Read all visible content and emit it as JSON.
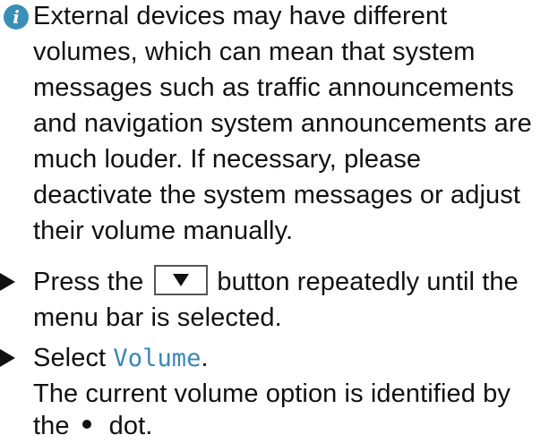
{
  "note": {
    "icon": "info-icon",
    "lines": [
      "External devices may have different",
      "volumes, which can mean that system",
      "messages such as traffic announcements",
      "and navigation system announcements are",
      "much louder. If necessary, please",
      "deactivate the system messages or adjust",
      "their volume manually."
    ]
  },
  "steps": [
    {
      "icon": "bullet-arrow-icon",
      "text_before_key": "Press the",
      "key_icon": "down-arrow-key-icon",
      "text_after_key": "button repeatedly until the",
      "continuation": "menu bar is selected."
    },
    {
      "icon": "bullet-arrow-icon",
      "text_before_term": "Select",
      "menu_term": "Volume",
      "text_after_term": ".",
      "result_line_1": "The current volume option is identified by",
      "result_prefix": "the",
      "indicator_icon": "dot-icon",
      "result_suffix": "dot."
    }
  ],
  "colors": {
    "info_icon": "#3a8fb7",
    "menu_term": "#3a86b6",
    "text": "#111111"
  }
}
